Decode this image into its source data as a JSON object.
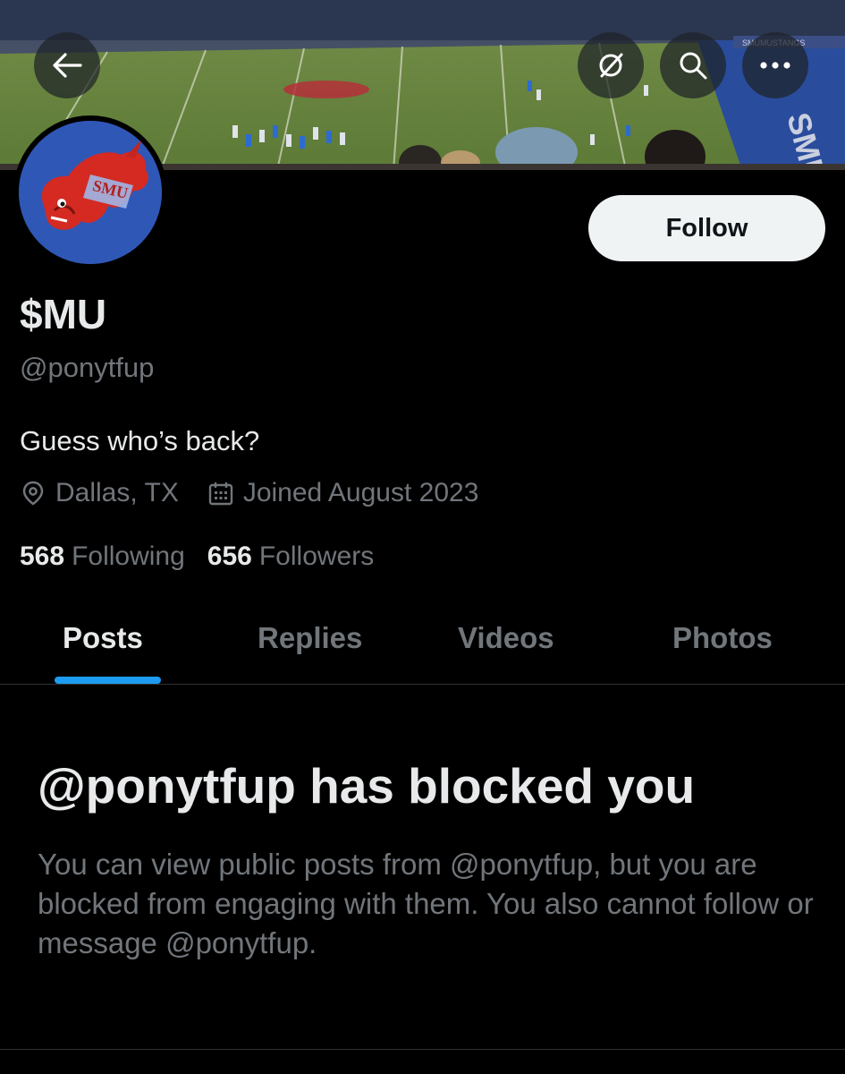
{
  "header": {
    "back_icon": "arrow-left-icon",
    "grok_icon": "grok-icon",
    "search_icon": "search-icon",
    "more_icon": "more-horizontal-icon"
  },
  "banner": {
    "end_zone_text": "SMU",
    "stadium_sign": "SMUMUSTANGS"
  },
  "avatar": {
    "text": "SMU"
  },
  "profile": {
    "follow_label": "Follow",
    "display_name": "$MU",
    "handle": "@ponytfup",
    "bio": "Guess who’s back?",
    "location": "Dallas, TX",
    "joined": "Joined August 2023",
    "following_count": "568",
    "following_label": "Following",
    "followers_count": "656",
    "followers_label": "Followers"
  },
  "tabs": {
    "posts": "Posts",
    "replies": "Replies",
    "videos": "Videos",
    "photos": "Photos"
  },
  "blocked": {
    "title": "@ponytfup has blocked you",
    "message": "You can view public posts from @ponytfup, but you are blocked from engaging with them. You also cannot follow or message @ponytfup."
  },
  "colors": {
    "accent": "#1d9bf0",
    "text_primary": "#e7e9ea",
    "text_secondary": "#71767b",
    "follow_bg": "#eff3f4"
  }
}
